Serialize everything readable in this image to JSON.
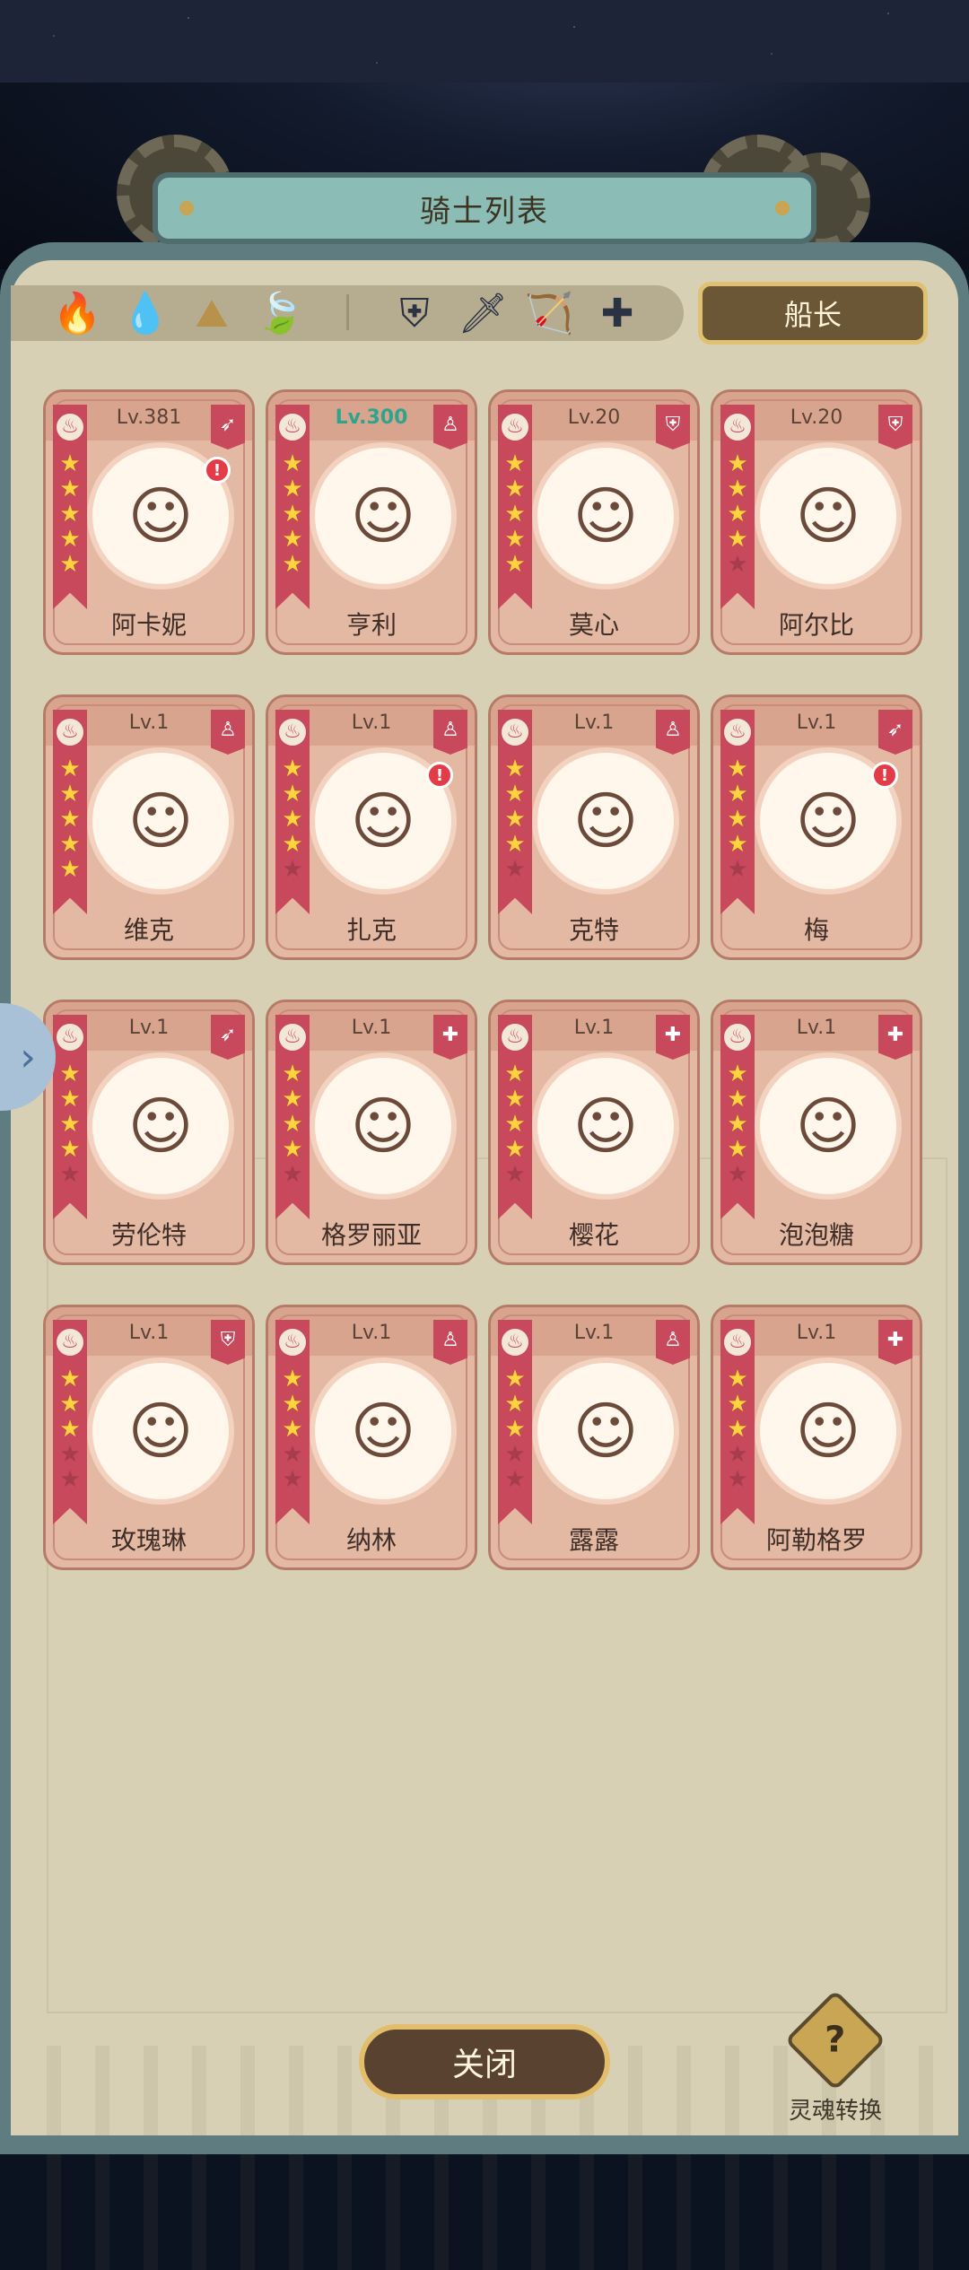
{
  "title": "骑士列表",
  "captain_label": "船长",
  "close_label": "关闭",
  "soul_transfer_label": "灵魂转换",
  "soul_icon_glyph": "?",
  "side_arrow_glyph": "›",
  "filters": {
    "elements": [
      {
        "name": "fire",
        "glyph": "🔥",
        "color": "#d7404e"
      },
      {
        "name": "water",
        "glyph": "💧",
        "color": "#3f7ed8"
      },
      {
        "name": "earth",
        "glyph": "⛰",
        "color": "#b8924a"
      },
      {
        "name": "wind",
        "glyph": "🍃",
        "color": "#4b9a55"
      }
    ],
    "classes": [
      {
        "name": "shield",
        "glyph": "⛨",
        "color": "#2b3244"
      },
      {
        "name": "sword",
        "glyph": "🗡",
        "color": "#2b3244"
      },
      {
        "name": "bow",
        "glyph": "🏹",
        "color": "#2b3244"
      },
      {
        "name": "support",
        "glyph": "✚",
        "color": "#2b3244"
      }
    ]
  },
  "knights": [
    {
      "name": "阿卡妮",
      "level": "Lv.381",
      "stars": 5,
      "class_icon": "bow-icon",
      "class_glyph": "➶",
      "alert": true,
      "level_highlight": false
    },
    {
      "name": "亨利",
      "level": "Lv.300",
      "stars": 5,
      "class_icon": "sword-icon",
      "class_glyph": "♙",
      "alert": false,
      "level_highlight": true
    },
    {
      "name": "莫心",
      "level": "Lv.20",
      "stars": 5,
      "class_icon": "shield-icon",
      "class_glyph": "⛨",
      "alert": false,
      "level_highlight": false
    },
    {
      "name": "阿尔比",
      "level": "Lv.20",
      "stars": 4,
      "class_icon": "shield-icon",
      "class_glyph": "⛨",
      "alert": false,
      "level_highlight": false
    },
    {
      "name": "维克",
      "level": "Lv.1",
      "stars": 5,
      "class_icon": "sword-icon",
      "class_glyph": "♙",
      "alert": false,
      "level_highlight": false
    },
    {
      "name": "扎克",
      "level": "Lv.1",
      "stars": 4,
      "class_icon": "sword-icon",
      "class_glyph": "♙",
      "alert": true,
      "level_highlight": false
    },
    {
      "name": "克特",
      "level": "Lv.1",
      "stars": 4,
      "class_icon": "sword-icon",
      "class_glyph": "♙",
      "alert": false,
      "level_highlight": false
    },
    {
      "name": "梅",
      "level": "Lv.1",
      "stars": 4,
      "class_icon": "bow-icon",
      "class_glyph": "➶",
      "alert": true,
      "level_highlight": false
    },
    {
      "name": "劳伦特",
      "level": "Lv.1",
      "stars": 4,
      "class_icon": "bow-icon",
      "class_glyph": "➶",
      "alert": false,
      "level_highlight": false
    },
    {
      "name": "格罗丽亚",
      "level": "Lv.1",
      "stars": 4,
      "class_icon": "support-icon",
      "class_glyph": "✚",
      "alert": false,
      "level_highlight": false
    },
    {
      "name": "樱花",
      "level": "Lv.1",
      "stars": 4,
      "class_icon": "support-icon",
      "class_glyph": "✚",
      "alert": false,
      "level_highlight": false
    },
    {
      "name": "泡泡糖",
      "level": "Lv.1",
      "stars": 4,
      "class_icon": "support-icon",
      "class_glyph": "✚",
      "alert": false,
      "level_highlight": false
    },
    {
      "name": "玫瑰琳",
      "level": "Lv.1",
      "stars": 3,
      "class_icon": "shield-icon",
      "class_glyph": "⛨",
      "alert": false,
      "level_highlight": false
    },
    {
      "name": "纳林",
      "level": "Lv.1",
      "stars": 3,
      "class_icon": "sword-icon",
      "class_glyph": "♙",
      "alert": false,
      "level_highlight": false
    },
    {
      "name": "露露",
      "level": "Lv.1",
      "stars": 3,
      "class_icon": "sword-icon",
      "class_glyph": "♙",
      "alert": false,
      "level_highlight": false
    },
    {
      "name": "阿勒格罗",
      "level": "Lv.1",
      "stars": 3,
      "class_icon": "support-icon",
      "class_glyph": "✚",
      "alert": false,
      "level_highlight": false
    }
  ]
}
